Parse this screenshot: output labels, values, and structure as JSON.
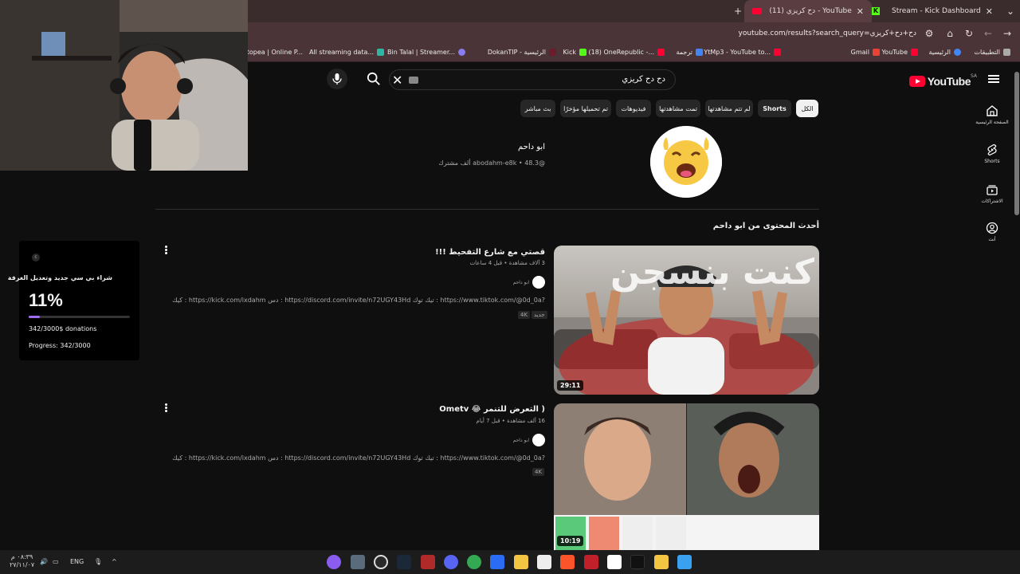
{
  "browser": {
    "tabs": [
      {
        "title": "Stream - Kick Dashboard"
      },
      {
        "title": "(11) دح كريزي - YouTube"
      }
    ],
    "url": "youtube.com/results?search_query=دح+دح+كريزي",
    "bookmarks": [
      {
        "label": "التطبيقات"
      },
      {
        "label": "الرئيسية"
      },
      {
        "label": "YouTube"
      },
      {
        "label": "Gmail"
      },
      {
        "label": "YtMp3 - YouTube to..."
      },
      {
        "label": "ترجمة"
      },
      {
        "label": "(18) OneRepublic -..."
      },
      {
        "label": "Kick"
      },
      {
        "label": "DokanTIP - الرئيسية"
      },
      {
        "label": "Bin Talal | Streamer..."
      },
      {
        "label": "All streaming data..."
      },
      {
        "label": "Photopea | Online P..."
      }
    ]
  },
  "youtube": {
    "logo": "YouTube",
    "region": "SA",
    "search": {
      "query": "دح دح كريزي"
    },
    "sidebar": [
      {
        "label": "الصفحة الرئيسية",
        "icon": "home-icon"
      },
      {
        "label": "Shorts",
        "icon": "shorts-icon"
      },
      {
        "label": "الاشتراكات",
        "icon": "subscriptions-icon"
      },
      {
        "label": "أنت",
        "icon": "you-icon"
      }
    ],
    "chips": [
      {
        "label": "الكل"
      },
      {
        "label": "Shorts"
      },
      {
        "label": "لم تتم مشاهدتها"
      },
      {
        "label": "تمت مشاهدتها"
      },
      {
        "label": "فيديوهات"
      },
      {
        "label": "تم تحميلها مؤخرًا"
      },
      {
        "label": "بث مباشر"
      }
    ],
    "channel": {
      "name": "ابو داحم",
      "handle": "@abodahm-e8k",
      "subscribers": "48.3 ألف مشترك"
    },
    "section_title": "أحدث المحتوى من ابو داحم",
    "videos": [
      {
        "title": "قصتي مع شارع التفحيط !!!",
        "meta": "3 آلاف مشاهدة • قبل 4 ساعات",
        "channel": "ابو داحم",
        "description": "كيك : https://kick.com/ixdahm دس : https://discord.com/invite/n72UGY43Hd تيك توك : https://www.tiktok.com/@0d_0a?",
        "badges": [
          "جديد",
          "4K"
        ],
        "duration": "29:11",
        "thumb_text": "كنت بنسجن"
      },
      {
        "title": "Ometv 😂 التعرض للتنمر )",
        "meta": "16 ألف مشاهدة • قبل 7 أيام",
        "channel": "ابو داحم",
        "description": "كيك : https://kick.com/ixdahm دس : https://discord.com/invite/n72UGY43Hd تيك توك : https://www.tiktok.com/@0d_0a?",
        "badges": [
          "4K"
        ],
        "duration": "10:19"
      }
    ]
  },
  "donation_goal": {
    "title": "شراء بي سي جديد وتعديل الغرفة",
    "percent_text": "11%",
    "percent": 11.4,
    "donations": "342/3000$ donations",
    "progress": "Progress: 342/3000"
  },
  "taskbar": {
    "lang": "ENG",
    "time": "٠٨:٣٩ م",
    "date": "٢٧/١١/٠٧"
  },
  "colors": {
    "youtube_red": "#ff0033",
    "kick_green": "#53fc18",
    "goal_fill": "#a26bf5"
  }
}
